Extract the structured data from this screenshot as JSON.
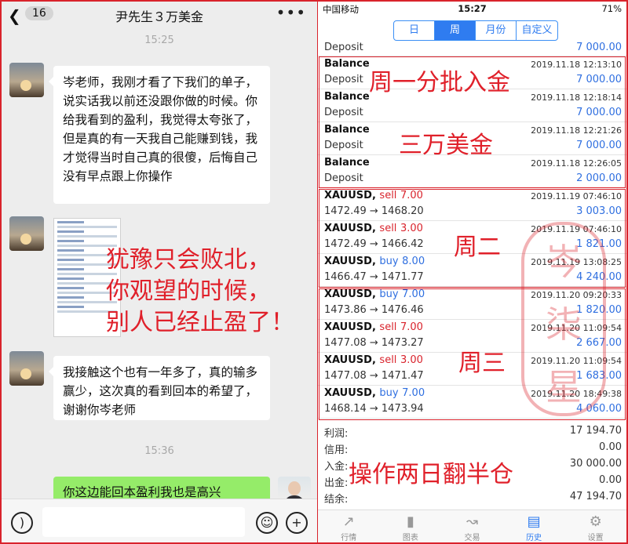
{
  "chat": {
    "badge": "16",
    "title": "尹先生３万美金",
    "more": "•••",
    "time1": "15:25",
    "msg1": "岑老师，我刚才看了下我们的单子，说实话我以前还没跟你做的时候。你给我看到的盈利，我觉得太夸张了，但是真的有一天我自己能赚到钱，我才觉得当时自己真的很傻，后悔自己没有早点跟上你操作",
    "msg2": "我接触这个也有一年多了，真的输多赢少，这次真的看到回本的希望了，谢谢你岑老师",
    "time2": "15:36",
    "msg3": "你这边能回本盈利我也是高兴"
  },
  "app": {
    "status": {
      "carrier": "中国移动",
      "time": "15:27",
      "battery": "71%"
    },
    "segments": [
      "日",
      "周",
      "月份",
      "自定义"
    ],
    "top_partial": {
      "label": "Deposit",
      "amount": "7 000.00"
    },
    "deposits": [
      {
        "title": "Balance",
        "label": "Deposit",
        "date": "2019.11.18 12:13:10",
        "amount": "7 000.00"
      },
      {
        "title": "Balance",
        "label": "Deposit",
        "date": "2019.11.18 12:18:14",
        "amount": "7 000.00"
      },
      {
        "title": "Balance",
        "label": "Deposit",
        "date": "2019.11.18 12:21:26",
        "amount": "7 000.00"
      },
      {
        "title": "Balance",
        "label": "Deposit",
        "date": "2019.11.18 12:26:05",
        "amount": "2 000.00"
      }
    ],
    "trades": [
      {
        "symbol": "XAUUSD,",
        "side": "sell",
        "lots": "7.00",
        "prices": "1472.49 → 1468.20",
        "date": "2019.11.19 07:46:10",
        "profit": "3 003.00"
      },
      {
        "symbol": "XAUUSD,",
        "side": "sell",
        "lots": "3.00",
        "prices": "1472.49 → 1466.42",
        "date": "2019.11.19 07:46:10",
        "profit": "1 821.00"
      },
      {
        "symbol": "XAUUSD,",
        "side": "buy",
        "lots": "8.00",
        "prices": "1466.47 → 1471.77",
        "date": "2019.11.19 13:08:25",
        "profit": "4 240.00"
      },
      {
        "symbol": "XAUUSD,",
        "side": "buy",
        "lots": "7.00",
        "prices": "1473.86 → 1476.46",
        "date": "2019.11.20 09:20:33",
        "profit": "1 820.00"
      },
      {
        "symbol": "XAUUSD,",
        "side": "sell",
        "lots": "7.00",
        "prices": "1477.08 → 1473.27",
        "date": "2019.11.20 11:09:54",
        "profit": "2 667.00"
      },
      {
        "symbol": "XAUUSD,",
        "side": "sell",
        "lots": "3.00",
        "prices": "1477.08 → 1471.47",
        "date": "2019.11.20 11:09:54",
        "profit": "1 683.00"
      },
      {
        "symbol": "XAUUSD,",
        "side": "buy",
        "lots": "7.00",
        "prices": "1468.14 → 1473.94",
        "date": "2019.11.20 18:49:38",
        "profit": "4 060.00"
      }
    ],
    "summary": [
      {
        "key": "利润:",
        "value": "17 194.70"
      },
      {
        "key": "信用:",
        "value": "0.00"
      },
      {
        "key": "入金:",
        "value": "30 000.00"
      },
      {
        "key": "出金:",
        "value": "0.00"
      },
      {
        "key": "结余:",
        "value": "47 194.70"
      }
    ],
    "tabs": [
      "行情",
      "图表",
      "交易",
      "历史",
      "设置"
    ]
  },
  "overlay": {
    "left_lines": [
      "犹豫只会败北，",
      "你观望的时候，",
      "别人已经止盈了！"
    ],
    "monday": "周一分批入金",
    "amount": "三万美金",
    "tuesday": "周二",
    "wednesday": "周三",
    "bottom": "操作两日翻半仓",
    "stamp": [
      "岑",
      "柒",
      "星"
    ]
  },
  "colors": {
    "accent": "#2f7cf0",
    "sell": "#d9232c",
    "buy": "#2f6fe0",
    "annotation": "#e0202a",
    "wechat_green": "#95ec69"
  }
}
